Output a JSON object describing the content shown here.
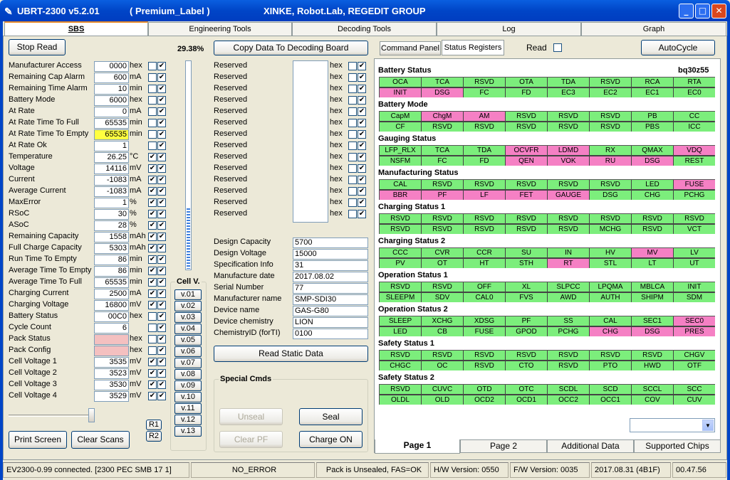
{
  "window": {
    "title": "UBRT-2300 v5.2.01",
    "label": "( Premium_Label )",
    "org": "XINKE, Robot.Lab, REGEDIT GROUP"
  },
  "tabs": [
    "SBS",
    "Engineering Tools",
    "Decoding Tools",
    "Log",
    "Graph"
  ],
  "left": {
    "stop_read": "Stop Read",
    "percent": "29.38%",
    "print_screen": "Print Screen",
    "clear_scans": "Clear Scans",
    "r1": "R1",
    "r2": "R2",
    "rows": [
      {
        "label": "Manufacturer Access",
        "value": "0000",
        "unit": "hex",
        "c1": false,
        "c2": true,
        "hl": ""
      },
      {
        "label": "Remaining Cap Alarm",
        "value": "600",
        "unit": "mA",
        "c1": false,
        "c2": true,
        "hl": ""
      },
      {
        "label": "Remaining Time Alarm",
        "value": "10",
        "unit": "min",
        "c1": false,
        "c2": true,
        "hl": ""
      },
      {
        "label": "Battery Mode",
        "value": "6000",
        "unit": "hex",
        "c1": false,
        "c2": true,
        "hl": ""
      },
      {
        "label": "At Rate",
        "value": "0",
        "unit": "mA",
        "c1": false,
        "c2": true,
        "hl": ""
      },
      {
        "label": "At Rate Time To Full",
        "value": "65535",
        "unit": "min",
        "c1": false,
        "c2": true,
        "hl": ""
      },
      {
        "label": "At Rate Time To Empty",
        "value": "65535",
        "unit": "min",
        "c1": false,
        "c2": true,
        "hl": "#ffff40"
      },
      {
        "label": "At Rate Ok",
        "value": "1",
        "unit": "",
        "c1": false,
        "c2": true,
        "hl": ""
      },
      {
        "label": "Temperature",
        "value": "26.25",
        "unit": "°C",
        "c1": true,
        "c2": true,
        "hl": ""
      },
      {
        "label": "Voltage",
        "value": "14116",
        "unit": "mV",
        "c1": true,
        "c2": true,
        "hl": ""
      },
      {
        "label": "Current",
        "value": "-1083",
        "unit": "mA",
        "c1": true,
        "c2": true,
        "hl": ""
      },
      {
        "label": "Average Current",
        "value": "-1083",
        "unit": "mA",
        "c1": true,
        "c2": true,
        "hl": ""
      },
      {
        "label": "MaxError",
        "value": "1",
        "unit": "%",
        "c1": true,
        "c2": true,
        "hl": ""
      },
      {
        "label": "RSoC",
        "value": "30",
        "unit": "%",
        "c1": true,
        "c2": true,
        "hl": ""
      },
      {
        "label": "ASoC",
        "value": "28",
        "unit": "%",
        "c1": true,
        "c2": true,
        "hl": ""
      },
      {
        "label": "Remaining Capacity",
        "value": "1558",
        "unit": "mAh",
        "c1": true,
        "c2": true,
        "hl": ""
      },
      {
        "label": "Full Charge Capacity",
        "value": "5303",
        "unit": "mAh",
        "c1": true,
        "c2": true,
        "hl": ""
      },
      {
        "label": "Run Time To Empty",
        "value": "86",
        "unit": "min",
        "c1": true,
        "c2": true,
        "hl": ""
      },
      {
        "label": "Average Time To Empty",
        "value": "86",
        "unit": "min",
        "c1": true,
        "c2": true,
        "hl": ""
      },
      {
        "label": "Average Time To Full",
        "value": "65535",
        "unit": "min",
        "c1": true,
        "c2": true,
        "hl": ""
      },
      {
        "label": "Charging Current",
        "value": "2500",
        "unit": "mA",
        "c1": true,
        "c2": true,
        "hl": ""
      },
      {
        "label": "Charging Voltage",
        "value": "16800",
        "unit": "mV",
        "c1": true,
        "c2": true,
        "hl": ""
      },
      {
        "label": "Battery Status",
        "value": "00C0",
        "unit": "hex",
        "c1": false,
        "c2": true,
        "hl": ""
      },
      {
        "label": "Cycle Count",
        "value": "6",
        "unit": "",
        "c1": false,
        "c2": true,
        "hl": ""
      },
      {
        "label": "Pack Status",
        "value": "",
        "unit": "hex",
        "c1": false,
        "c2": true,
        "hl": "#f4c0c0"
      },
      {
        "label": "Pack Config",
        "value": "",
        "unit": "hex",
        "c1": false,
        "c2": true,
        "hl": "#f4c0c0"
      },
      {
        "label": "Cell Voltage 1",
        "value": "3535",
        "unit": "mV",
        "c1": true,
        "c2": true,
        "hl": ""
      },
      {
        "label": "Cell Voltage 2",
        "value": "3523",
        "unit": "mV",
        "c1": true,
        "c2": true,
        "hl": ""
      },
      {
        "label": "Cell Voltage 3",
        "value": "3530",
        "unit": "mV",
        "c1": true,
        "c2": true,
        "hl": ""
      },
      {
        "label": "Cell Voltage 4",
        "value": "3529",
        "unit": "mV",
        "c1": true,
        "c2": true,
        "hl": ""
      }
    ],
    "cellv": {
      "title": "Cell V.",
      "items": [
        "v.01",
        "v.02",
        "v.03",
        "v.04",
        "v.05",
        "v.06",
        "v.07",
        "v.08",
        "v.09",
        "v.10",
        "v.11",
        "v.12",
        "v.13"
      ],
      "level": 0.29
    }
  },
  "mid": {
    "copy": "Copy Data To Decoding Board",
    "reserved": {
      "label": "Reserved",
      "unit": "hex",
      "count": 14
    },
    "static": [
      {
        "label": "Design Capacity",
        "value": "5700"
      },
      {
        "label": "Design Voltage",
        "value": "15000"
      },
      {
        "label": "Specification Info",
        "value": "31"
      },
      {
        "label": "Manufacture date",
        "value": "2017.08.02"
      },
      {
        "label": "Serial Number",
        "value": "77"
      },
      {
        "label": "Manufacturer name",
        "value": "SMP-SDI30"
      },
      {
        "label": "Device name",
        "value": "GAS-G80"
      },
      {
        "label": "Device chemistry",
        "value": "LION"
      },
      {
        "label": "ChemistryID (forTI)",
        "value": "0100"
      }
    ],
    "read_static": "Read Static Data",
    "special": {
      "title": "Special Cmds",
      "unseal": "Unseal",
      "seal": "Seal",
      "clear_pf": "Clear PF",
      "charge_on": "Charge ON"
    }
  },
  "right": {
    "command_panel": "Command Panel",
    "status_registers": "Status Registers",
    "read": "Read",
    "autocycle": "AutoCycle",
    "chip": "bq30z55",
    "groups": [
      {
        "title": "Battery Status",
        "rows": [
          [
            "OCA",
            "TCA",
            "RSVD",
            "OTA",
            "TDA",
            "RSVD",
            "RCA",
            "RTA"
          ],
          [
            "INIT",
            "DSG",
            "FC",
            "FD",
            "EC3",
            "EC2",
            "EC1",
            "EC0"
          ]
        ],
        "pink": [
          [],
          [
            0,
            1
          ]
        ]
      },
      {
        "title": "Battery Mode",
        "rows": [
          [
            "CapM",
            "ChgM",
            "AM",
            "RSVD",
            "RSVD",
            "RSVD",
            "PB",
            "CC"
          ],
          [
            "CF",
            "RSVD",
            "RSVD",
            "RSVD",
            "RSVD",
            "RSVD",
            "PBS",
            "ICC"
          ]
        ],
        "pink": [
          [
            1,
            2
          ],
          []
        ]
      },
      {
        "title": "Gauging Status",
        "rows": [
          [
            "LFP_RLX",
            "TCA",
            "TDA",
            "OCVFR",
            "LDMD",
            "RX",
            "QMAX",
            "VDQ"
          ],
          [
            "NSFM",
            "FC",
            "FD",
            "QEN",
            "VOK",
            "RU",
            "DSG",
            "REST"
          ]
        ],
        "pink": [
          [
            3,
            4,
            7
          ],
          [
            3,
            4,
            5,
            6
          ]
        ]
      },
      {
        "title": "Manufacturing Status",
        "rows": [
          [
            "CAL",
            "RSVD",
            "RSVD",
            "RSVD",
            "RSVD",
            "RSVD",
            "LED",
            "FUSE"
          ],
          [
            "BBR",
            "PF",
            "LF",
            "FET",
            "GAUGE",
            "DSG",
            "CHG",
            "PCHG"
          ]
        ],
        "pink": [
          [
            7
          ],
          [
            0,
            1,
            2,
            3,
            4
          ]
        ]
      },
      {
        "title": "Charging Status 1",
        "rows": [
          [
            "RSVD",
            "RSVD",
            "RSVD",
            "RSVD",
            "RSVD",
            "RSVD",
            "RSVD",
            "RSVD"
          ],
          [
            "RSVD",
            "RSVD",
            "RSVD",
            "RSVD",
            "RSVD",
            "MCHG",
            "RSVD",
            "VCT"
          ]
        ],
        "pink": [
          [],
          []
        ]
      },
      {
        "title": "Charging Status 2",
        "rows": [
          [
            "CCC",
            "CVR",
            "CCR",
            "SU",
            "IN",
            "HV",
            "MV",
            "LV"
          ],
          [
            "PV",
            "OT",
            "HT",
            "STH",
            "RT",
            "STL",
            "LT",
            "UT"
          ]
        ],
        "pink": [
          [
            6
          ],
          [
            4
          ]
        ]
      },
      {
        "title": "Operation Status 1",
        "rows": [
          [
            "RSVD",
            "RSVD",
            "OFF",
            "XL",
            "SLPCC",
            "LPQMA",
            "MBLCA",
            "INIT"
          ],
          [
            "SLEEPM",
            "SDV",
            "CAL0",
            "FVS",
            "AWD",
            "AUTH",
            "SHIPM",
            "SDM"
          ]
        ],
        "pink": [
          [],
          []
        ]
      },
      {
        "title": "Operation Status 2",
        "rows": [
          [
            "SLEEP",
            "XCHG",
            "XDSG",
            "PF",
            "SS",
            "CAL",
            "SEC1",
            "SEC0"
          ],
          [
            "LED",
            "CB",
            "FUSE",
            "GPOD",
            "PCHG",
            "CHG",
            "DSG",
            "PRES"
          ]
        ],
        "pink": [
          [
            7
          ],
          [
            5,
            6,
            7
          ]
        ]
      },
      {
        "title": "Safety Status 1",
        "rows": [
          [
            "RSVD",
            "RSVD",
            "RSVD",
            "RSVD",
            "RSVD",
            "RSVD",
            "RSVD",
            "CHGV"
          ],
          [
            "CHGC",
            "OC",
            "RSVD",
            "CTO",
            "RSVD",
            "PTO",
            "HWD",
            "OTF"
          ]
        ],
        "pink": [
          [],
          []
        ]
      },
      {
        "title": "Safety Status 2",
        "rows": [
          [
            "RSVD",
            "CUVC",
            "OTD",
            "OTC",
            "SCDL",
            "SCD",
            "SCCL",
            "SCC"
          ],
          [
            "OLDL",
            "OLD",
            "OCD2",
            "OCD1",
            "OCC2",
            "OCC1",
            "COV",
            "CUV"
          ]
        ],
        "pink": [
          [],
          []
        ]
      }
    ],
    "pages": [
      "Page 1",
      "Page 2",
      "Additional Data",
      "Supported Chips"
    ]
  },
  "status": [
    "EV2300-0.99 connected. [2300  PEC  SMB  17 1]",
    "NO_ERROR",
    "Pack is Unsealed, FAS=OK",
    "H/W Version: 0550",
    "F/W Version: 0035",
    "2017.08.31  (4B1F)",
    "00.47.56"
  ],
  "colors": {
    "green": "#7cee7c",
    "pink": "#f580c4",
    "title": "#0045c7"
  }
}
